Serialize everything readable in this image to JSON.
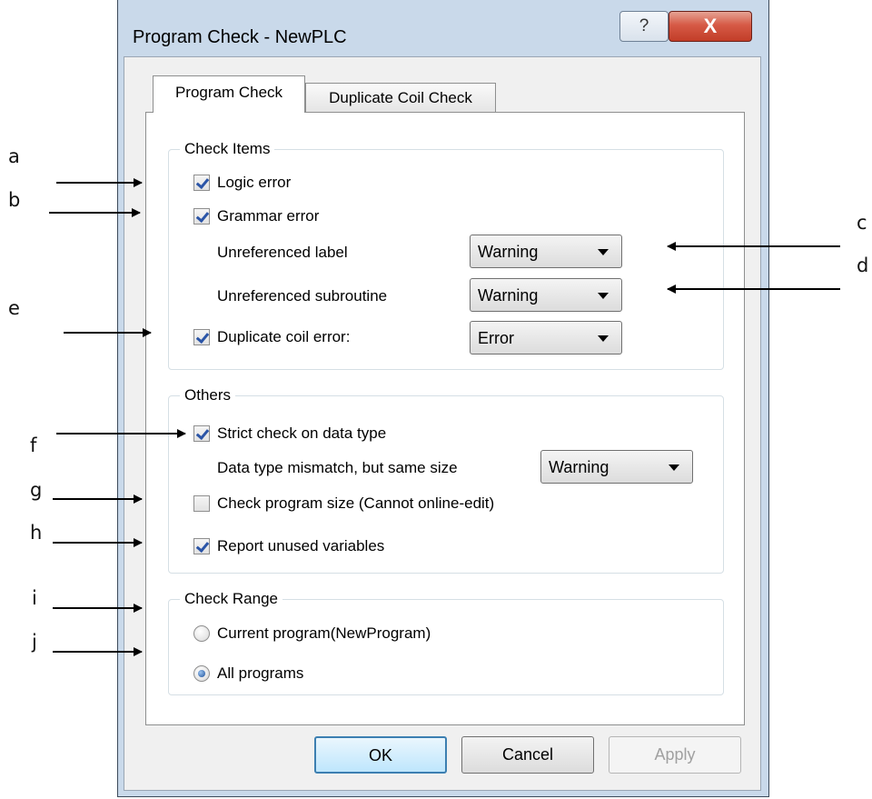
{
  "window": {
    "title": "Program Check - NewPLC",
    "help_label": "?",
    "close_label": "X"
  },
  "tabs": [
    {
      "label": "Program Check",
      "active": true
    },
    {
      "label": "Duplicate Coil Check",
      "active": false
    }
  ],
  "check_items": {
    "title": "Check Items",
    "logic_error": {
      "label": "Logic error",
      "checked": true
    },
    "grammar_error": {
      "label": "Grammar error",
      "checked": true
    },
    "unreferenced_label": {
      "label": "Unreferenced label",
      "value": "Warning"
    },
    "unreferenced_subroutine": {
      "label": "Unreferenced subroutine",
      "value": "Warning"
    },
    "duplicate_coil": {
      "label": "Duplicate coil error:",
      "checked": true,
      "value": "Error"
    }
  },
  "others": {
    "title": "Others",
    "strict_check": {
      "label": "Strict check on data type",
      "checked": true
    },
    "mismatch": {
      "label": "Data type mismatch, but same size",
      "value": "Warning"
    },
    "program_size": {
      "label": "Check program size (Cannot online-edit)",
      "checked": false
    },
    "unused_vars": {
      "label": "Report unused variables",
      "checked": true
    }
  },
  "check_range": {
    "title": "Check Range",
    "current": {
      "label": "Current program(NewProgram)",
      "selected": false
    },
    "all": {
      "label": "All programs",
      "selected": true
    }
  },
  "buttons": {
    "ok": "OK",
    "cancel": "Cancel",
    "apply": "Apply"
  },
  "annotations": [
    "a",
    "b",
    "c",
    "d",
    "e",
    "f",
    "g",
    "h",
    "i",
    "j"
  ],
  "colors": {
    "window_frame": "#c9d9ea",
    "close_button": "#c23d28",
    "check_mark": "#2b55a7",
    "ok_border": "#3c7fb1"
  }
}
